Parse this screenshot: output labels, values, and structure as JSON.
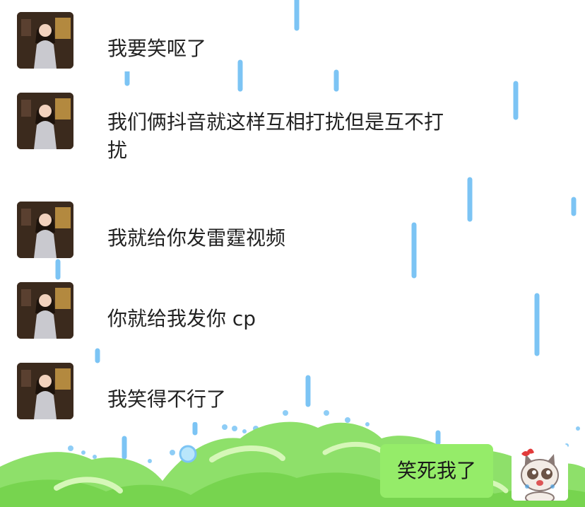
{
  "messages": [
    {
      "text": "我要笑呕了"
    },
    {
      "text": "我们俩抖音就这样互相打扰但是互不打扰"
    },
    {
      "text": "我就给你发雷霆视频"
    },
    {
      "text": "你就给我发你 cp"
    },
    {
      "text": "我笑得不行了"
    }
  ],
  "my_message": {
    "text": "笑死我了"
  },
  "colors": {
    "me_bubble": "#95ec69",
    "other_bubble": "#ffffff",
    "rain": "#7cc4f4",
    "clover": "#8ee06a"
  }
}
